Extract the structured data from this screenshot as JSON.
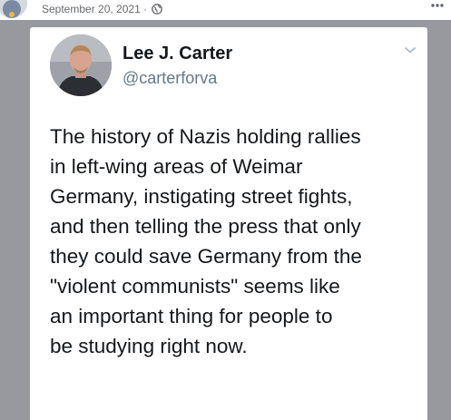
{
  "post": {
    "date": "September 20, 2021 ·"
  },
  "tweet": {
    "name": "Lee J. Carter",
    "handle": "@carterforva",
    "lines": [
      "The history of Nazis holding rallies",
      "in left-wing areas of Weimar",
      "Germany, instigating street fights,",
      "and then telling the press that only",
      "they could save Germany from the",
      "\"violent communists\" seems like",
      "an important thing for people to",
      "be studying right now."
    ]
  },
  "colors": {
    "backdrop": "#97999e",
    "card": "#ffffff",
    "text_primary": "#14171a",
    "text_secondary": "#657786"
  }
}
